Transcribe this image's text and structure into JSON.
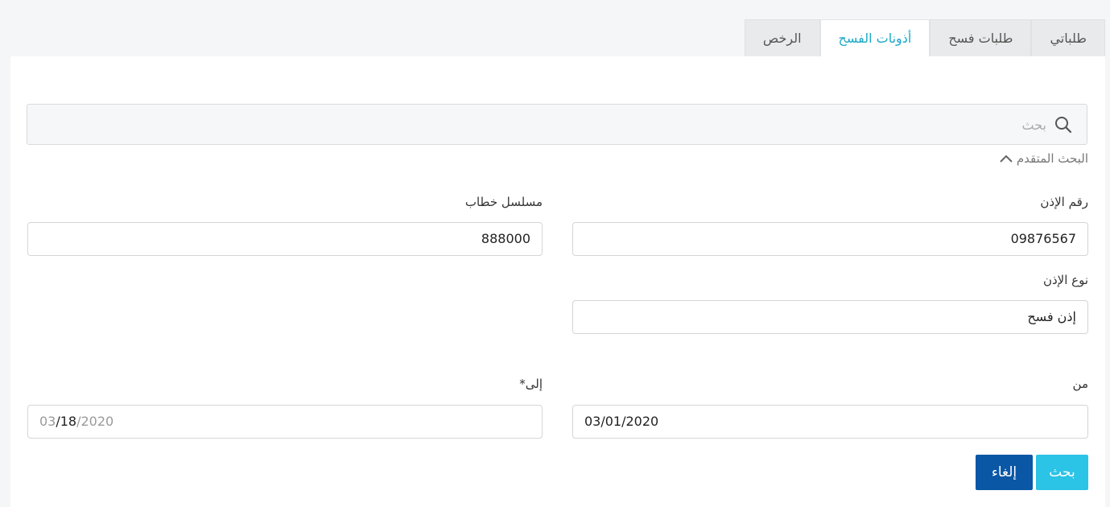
{
  "tabs": [
    {
      "label": "طلباتي"
    },
    {
      "label": "طلبات فسح"
    },
    {
      "label": "أذونات الفسح"
    },
    {
      "label": "الرخص"
    }
  ],
  "search": {
    "placeholder": "بحث"
  },
  "advanced": {
    "label": "البحث المتقدم"
  },
  "form": {
    "permit_number": {
      "label": "رقم الإذن",
      "value": "09876567"
    },
    "letter_serial": {
      "label": "مسلسل خطاب",
      "value": "888000"
    },
    "permit_type": {
      "label": "نوع الإذن",
      "value": "إذن فسح"
    },
    "from": {
      "label": "من",
      "value": "03/01/2020"
    },
    "to": {
      "label": "إلى*",
      "month": "03",
      "sep1": "/",
      "day": "18",
      "sep2": "/",
      "year": "2020"
    }
  },
  "buttons": {
    "search": "بحث",
    "cancel": "إلغاء"
  },
  "colors": {
    "accent": "#2bc3e6",
    "primary": "#0a57a6",
    "active_tab_text": "#1ba8c8"
  }
}
